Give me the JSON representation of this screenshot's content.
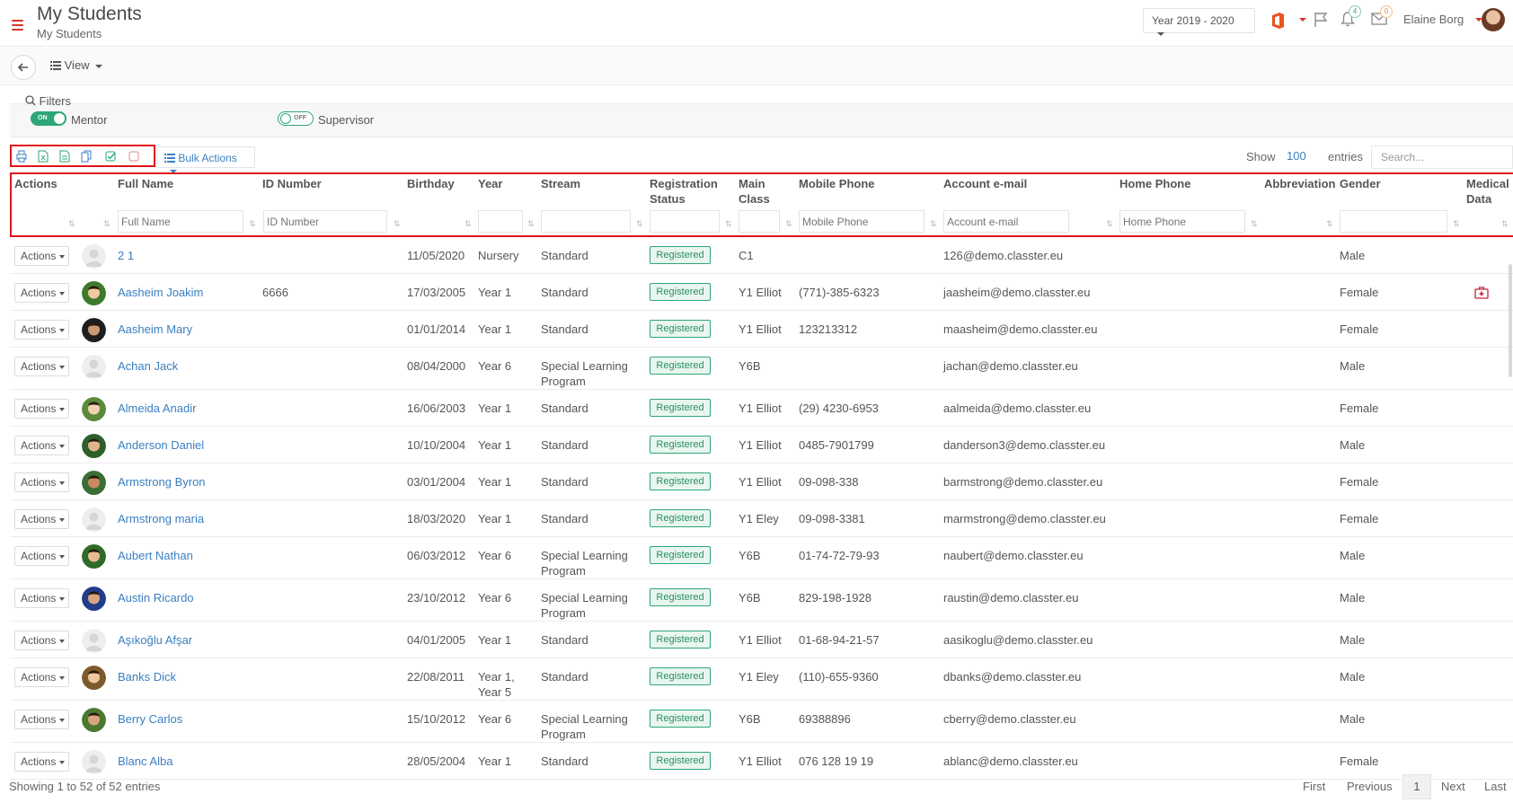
{
  "header": {
    "title": "My Students",
    "subtitle": "My Students",
    "year": "Year 2019 - 2020",
    "notifications_count": "4",
    "mail_count": "0",
    "user_name": "Elaine Borg"
  },
  "subbar": {
    "view_label": "View"
  },
  "filters": {
    "label": "Filters",
    "mentor_toggle": "ON",
    "mentor_label": "Mentor",
    "supervisor_toggle": "OFF",
    "supervisor_label": "Supervisor"
  },
  "toolbar": {
    "bulk_actions": "Bulk Actions",
    "show_label": "Show",
    "show_value": "100",
    "entries_label": "entries",
    "search_placeholder": "Search..."
  },
  "table": {
    "columns": {
      "actions": "Actions",
      "full_name": "Full Name",
      "id_number": "ID Number",
      "birthday": "Birthday",
      "year": "Year",
      "stream": "Stream",
      "registration_status": "Registration Status",
      "main_class": "Main Class",
      "mobile_phone": "Mobile Phone",
      "account_email": "Account e-mail",
      "home_phone": "Home Phone",
      "abbreviation": "Abbreviation",
      "gender": "Gender",
      "medical_data": "Medical Data"
    },
    "filter_placeholders": {
      "full_name": "Full Name",
      "id_number": "ID Number",
      "mobile_phone": "Mobile Phone",
      "account_email": "Account e-mail",
      "home_phone": "Home Phone"
    },
    "actions_label": "Actions",
    "rows": [
      {
        "name": "2 1",
        "id": "",
        "birthday": "11/05/2020",
        "year": "Nursery",
        "stream": "Standard",
        "status": "Registered",
        "class": "C1",
        "mobile": "",
        "email": "126@demo.classter.eu",
        "gender": "Male",
        "photo": "placeholder",
        "medical": false
      },
      {
        "name": "Aasheim Joakim",
        "id": "6666",
        "birthday": "17/03/2005",
        "year": "Year 1",
        "stream": "Standard",
        "status": "Registered",
        "class": "Y1 Elliot",
        "mobile": "(771)-385-6323",
        "email": "jaasheim@demo.classter.eu",
        "gender": "Female",
        "photo": "photo",
        "medical": true
      },
      {
        "name": "Aasheim Mary",
        "id": "",
        "birthday": "01/01/2014",
        "year": "Year 1",
        "stream": "Standard",
        "status": "Registered",
        "class": "Y1 Elliot",
        "mobile": "123213312",
        "email": "maasheim@demo.classter.eu",
        "gender": "Female",
        "photo": "photo",
        "medical": false
      },
      {
        "name": "Achan Jack",
        "id": "",
        "birthday": "08/04/2000",
        "year": "Year 6",
        "stream": "Special Learning Program",
        "status": "Registered",
        "class": "Y6B",
        "mobile": "",
        "email": "jachan@demo.classter.eu",
        "gender": "Male",
        "photo": "placeholder",
        "medical": false
      },
      {
        "name": "Almeida Anadir",
        "id": "",
        "birthday": "16/06/2003",
        "year": "Year 1",
        "stream": "Standard",
        "status": "Registered",
        "class": "Y1 Elliot",
        "mobile": "(29) 4230-6953",
        "email": "aalmeida@demo.classter.eu",
        "gender": "Female",
        "photo": "photo",
        "medical": false
      },
      {
        "name": "Anderson Daniel",
        "id": "",
        "birthday": "10/10/2004",
        "year": "Year 1",
        "stream": "Standard",
        "status": "Registered",
        "class": "Y1 Elliot",
        "mobile": "0485-7901799",
        "email": "danderson3@demo.classter.eu",
        "gender": "Male",
        "photo": "photo",
        "medical": false
      },
      {
        "name": "Armstrong Byron",
        "id": "",
        "birthday": "03/01/2004",
        "year": "Year 1",
        "stream": "Standard",
        "status": "Registered",
        "class": "Y1 Elliot",
        "mobile": "09-098-338",
        "email": "barmstrong@demo.classter.eu",
        "gender": "Female",
        "photo": "photo",
        "medical": false
      },
      {
        "name": "Armstrong maria",
        "id": "",
        "birthday": "18/03/2020",
        "year": "Year 1",
        "stream": "Standard",
        "status": "Registered",
        "class": "Y1 Eley",
        "mobile": "09-098-3381",
        "email": "marmstrong@demo.classter.eu",
        "gender": "Female",
        "photo": "placeholder",
        "medical": false
      },
      {
        "name": "Aubert Nathan",
        "id": "",
        "birthday": "06/03/2012",
        "year": "Year 6",
        "stream": "Special Learning Program",
        "status": "Registered",
        "class": "Y6B",
        "mobile": "01-74-72-79-93",
        "email": "naubert@demo.classter.eu",
        "gender": "Male",
        "photo": "photo",
        "medical": false
      },
      {
        "name": "Austin Ricardo",
        "id": "",
        "birthday": "23/10/2012",
        "year": "Year 6",
        "stream": "Special Learning Program",
        "status": "Registered",
        "class": "Y6B",
        "mobile": "829-198-1928",
        "email": "raustin@demo.classter.eu",
        "gender": "Male",
        "photo": "photo",
        "medical": false
      },
      {
        "name": "Aşıkoğlu Afşar",
        "id": "",
        "birthday": "04/01/2005",
        "year": "Year 1",
        "stream": "Standard",
        "status": "Registered",
        "class": "Y1 Elliot",
        "mobile": "01-68-94-21-57",
        "email": "aasikoglu@demo.classter.eu",
        "gender": "Male",
        "photo": "placeholder",
        "medical": false
      },
      {
        "name": "Banks Dick",
        "id": "",
        "birthday": "22/08/2011",
        "year": "Year 1, Year 5",
        "stream": "Standard",
        "status": "Registered",
        "class": "Y1 Eley",
        "mobile": "(110)-655-9360",
        "email": "dbanks@demo.classter.eu",
        "gender": "Male",
        "photo": "photo",
        "medical": false
      },
      {
        "name": "Berry Carlos",
        "id": "",
        "birthday": "15/10/2012",
        "year": "Year 6",
        "stream": "Special Learning Program",
        "status": "Registered",
        "class": "Y6B",
        "mobile": "69388896",
        "email": "cberry@demo.classter.eu",
        "gender": "Male",
        "photo": "photo",
        "medical": false
      },
      {
        "name": "Blanc Alba",
        "id": "",
        "birthday": "28/05/2004",
        "year": "Year 1",
        "stream": "Standard",
        "status": "Registered",
        "class": "Y1 Elliot",
        "mobile": "076 128 19 19",
        "email": "ablanc@demo.classter.eu",
        "gender": "Female",
        "photo": "placeholder",
        "medical": false
      }
    ]
  },
  "footer": {
    "info": "Showing 1 to 52 of 52 entries",
    "first": "First",
    "previous": "Previous",
    "current_page": "1",
    "next": "Next",
    "last": "Last"
  },
  "colors": {
    "accent": "#3a7fc1",
    "success": "#2fa679",
    "highlight": "#e0141a",
    "brand_red": "#d9342b"
  }
}
